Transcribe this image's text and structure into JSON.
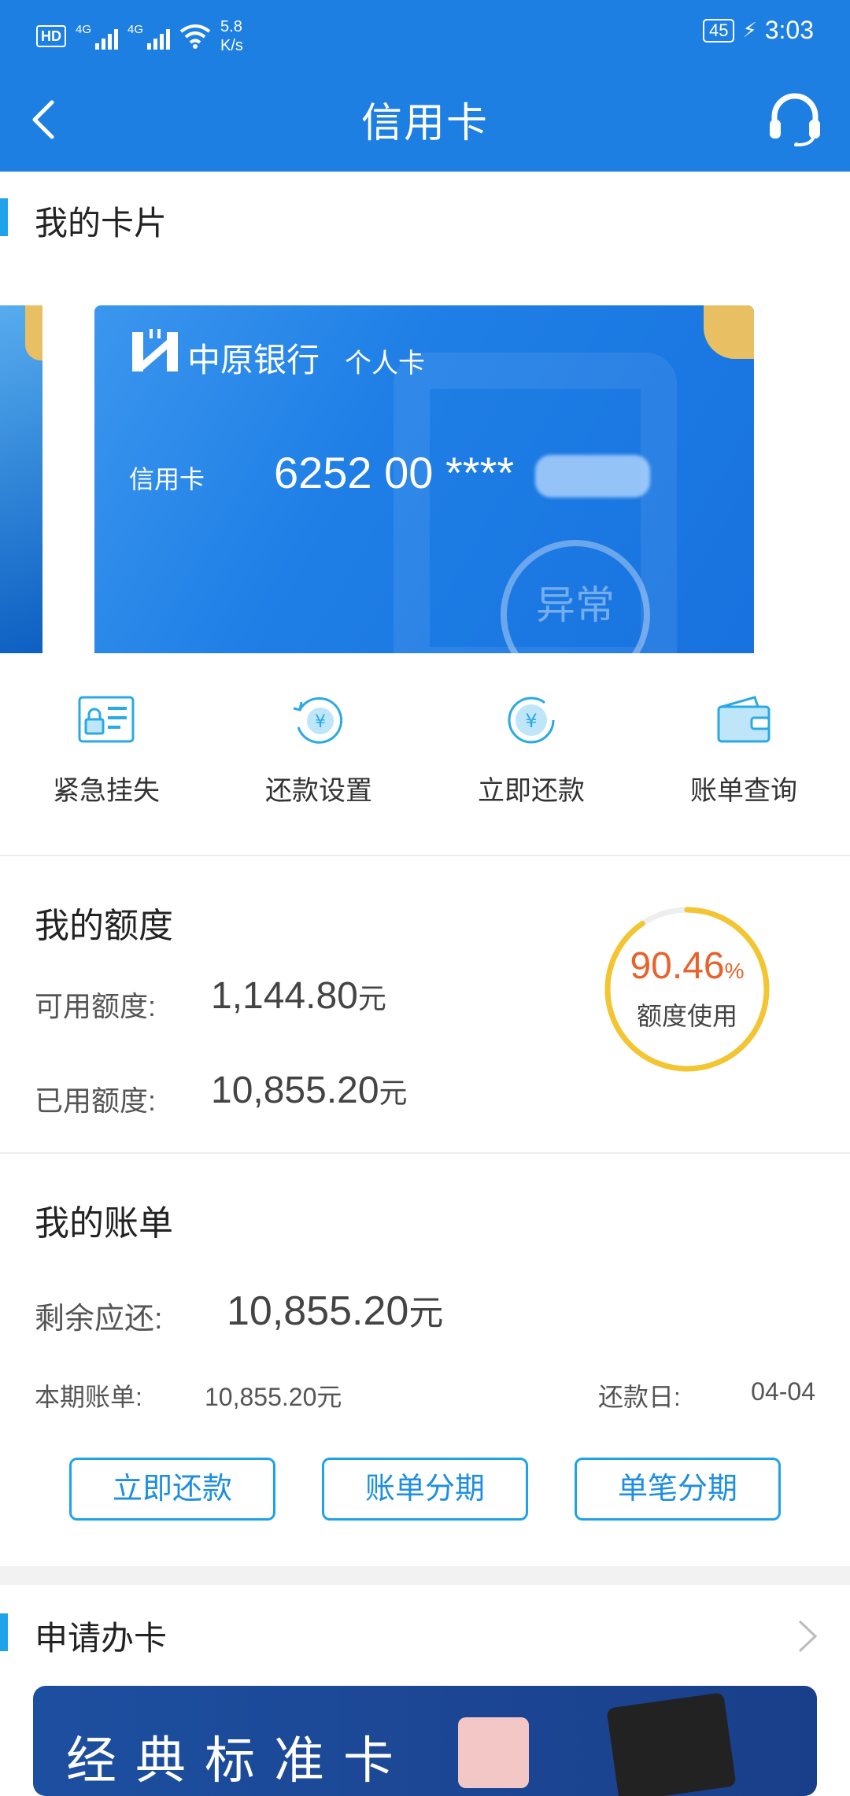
{
  "status_bar": {
    "hd": "HD",
    "net1": "4G",
    "net2": "4G",
    "speed_top": "5.8",
    "speed_unit": "K/s",
    "battery": "45",
    "time": "3:03"
  },
  "header": {
    "title": "信用卡"
  },
  "my_cards": {
    "section_title": "我的卡片",
    "card": {
      "bank_name": "中原银行",
      "card_type": "个人卡",
      "label": "信用卡",
      "number": "6252 00 ****",
      "stamp": "异常"
    }
  },
  "actions": [
    {
      "label": "紧急挂失",
      "icon": "lock-card-icon"
    },
    {
      "label": "还款设置",
      "icon": "repay-settings-icon"
    },
    {
      "label": "立即还款",
      "icon": "yuan-coin-icon"
    },
    {
      "label": "账单查询",
      "icon": "wallet-icon"
    }
  ],
  "quota": {
    "title": "我的额度",
    "available_label": "可用额度:",
    "available_value": "1,144.80",
    "used_label": "已用额度:",
    "used_value": "10,855.20",
    "unit": "元",
    "usage_percent": "90.46",
    "usage_percent_sign": "%",
    "usage_fraction": 0.9046,
    "usage_caption": "额度使用"
  },
  "bill": {
    "title": "我的账单",
    "remaining_label": "剩余应还:",
    "remaining_value": "10,855.20",
    "unit": "元",
    "current_label": "本期账单:",
    "current_value": "10,855.20元",
    "due_label": "还款日:",
    "due_value": "04-04",
    "buttons": [
      "立即还款",
      "账单分期",
      "单笔分期"
    ]
  },
  "apply": {
    "section_title": "申请办卡",
    "banner_title": "经典标准卡"
  },
  "colors": {
    "brand_blue": "#1e7fe3",
    "accent_cyan": "#1ea3ea",
    "usage_orange": "#e8622a",
    "ring_yellow": "#f2c531"
  }
}
